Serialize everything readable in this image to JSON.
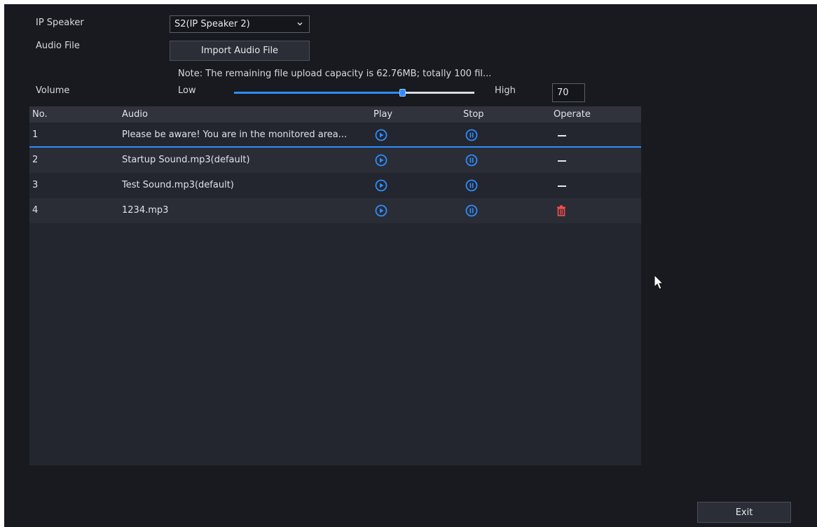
{
  "form": {
    "ip_speaker_label": "IP Speaker",
    "ip_speaker_value": "S2(IP Speaker 2)",
    "audio_file_label": "Audio File",
    "import_button": "Import Audio File",
    "note": "Note: The remaining file upload capacity is 62.76MB; totally 100 fil...",
    "volume_label": "Volume",
    "volume_low": "Low",
    "volume_high": "High",
    "volume_value": "70",
    "volume_level": 0.7
  },
  "table": {
    "headers": {
      "no": "No.",
      "audio": "Audio",
      "play": "Play",
      "stop": "Stop",
      "operate": "Operate"
    },
    "rows": [
      {
        "no": "1",
        "audio": "Please be aware! You are in the monitored area...",
        "operate": "none"
      },
      {
        "no": "2",
        "audio": "Startup Sound.mp3(default)",
        "operate": "none"
      },
      {
        "no": "3",
        "audio": "Test Sound.mp3(default)",
        "operate": "none"
      },
      {
        "no": "4",
        "audio": "1234.mp3",
        "operate": "delete"
      }
    ]
  },
  "footer": {
    "exit_button": "Exit"
  },
  "colors": {
    "accent": "#2e8cff",
    "delete": "#ff4d4f",
    "background": "#181a1f"
  },
  "icons": {
    "play": "play-circle-icon",
    "stop": "pause-circle-icon",
    "delete": "trash-icon",
    "select": "chevron-down-icon"
  }
}
